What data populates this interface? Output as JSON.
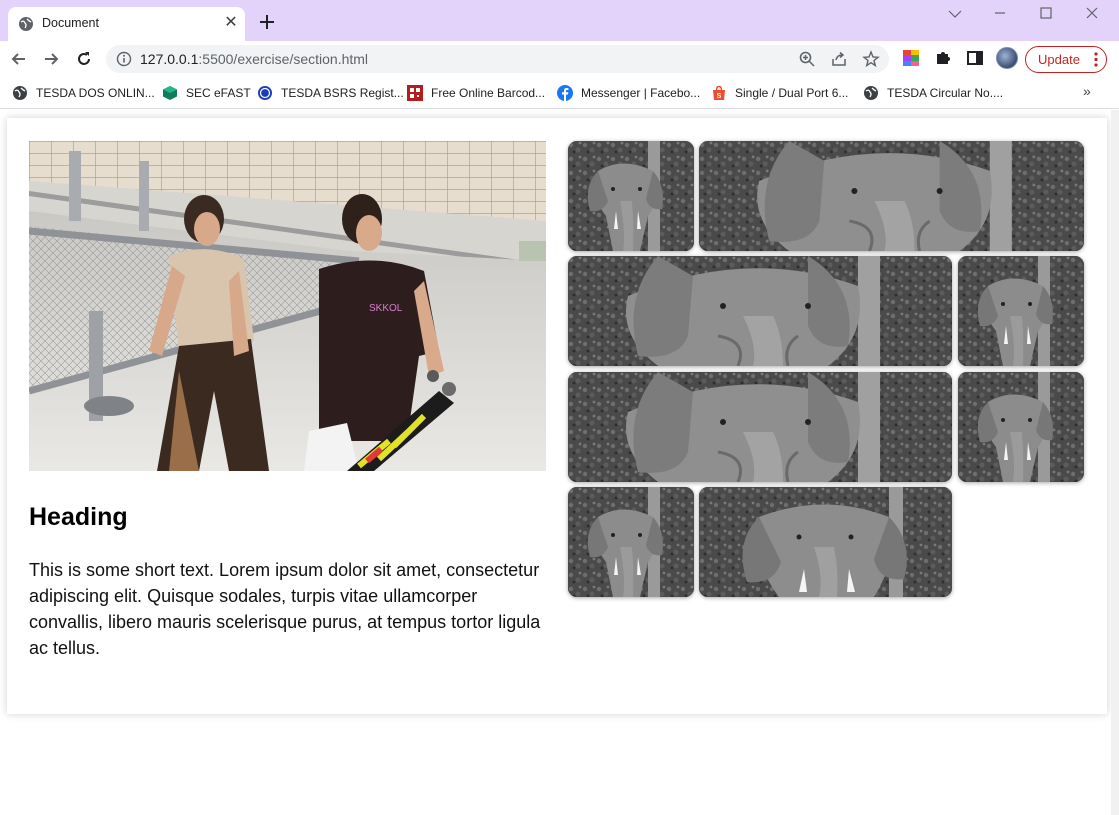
{
  "browser": {
    "tab_title": "Document",
    "url_host": "127.0.0.1",
    "url_rest": ":5500/exercise/section.html",
    "update_label": "Update",
    "bookmarks": [
      {
        "label": "TESDA DOS ONLIN...",
        "icon": "globe-icon"
      },
      {
        "label": "SEC eFAST",
        "icon": "cube-icon"
      },
      {
        "label": "TESDA BSRS Regist...",
        "icon": "seal-icon"
      },
      {
        "label": "Free Online Barcod...",
        "icon": "barcode-icon"
      },
      {
        "label": "Messenger | Facebo...",
        "icon": "facebook-icon"
      },
      {
        "label": "Single / Dual Port 6...",
        "icon": "shopee-icon"
      },
      {
        "label": "TESDA Circular No....",
        "icon": "globe-icon"
      }
    ],
    "more_label": "»"
  },
  "section": {
    "heading": "Heading",
    "text": "This is some short text. Lorem ipsum dolor sit amet, consectetur adipiscing elit. Quisque sodales, turpis vitae ullamcorper convallis, libero mauris scelerisque purus, at tempus tortor ligula ac tellus."
  },
  "colors": {
    "titlebar": "#e3d3fb",
    "update_accent": "#c5221f"
  }
}
